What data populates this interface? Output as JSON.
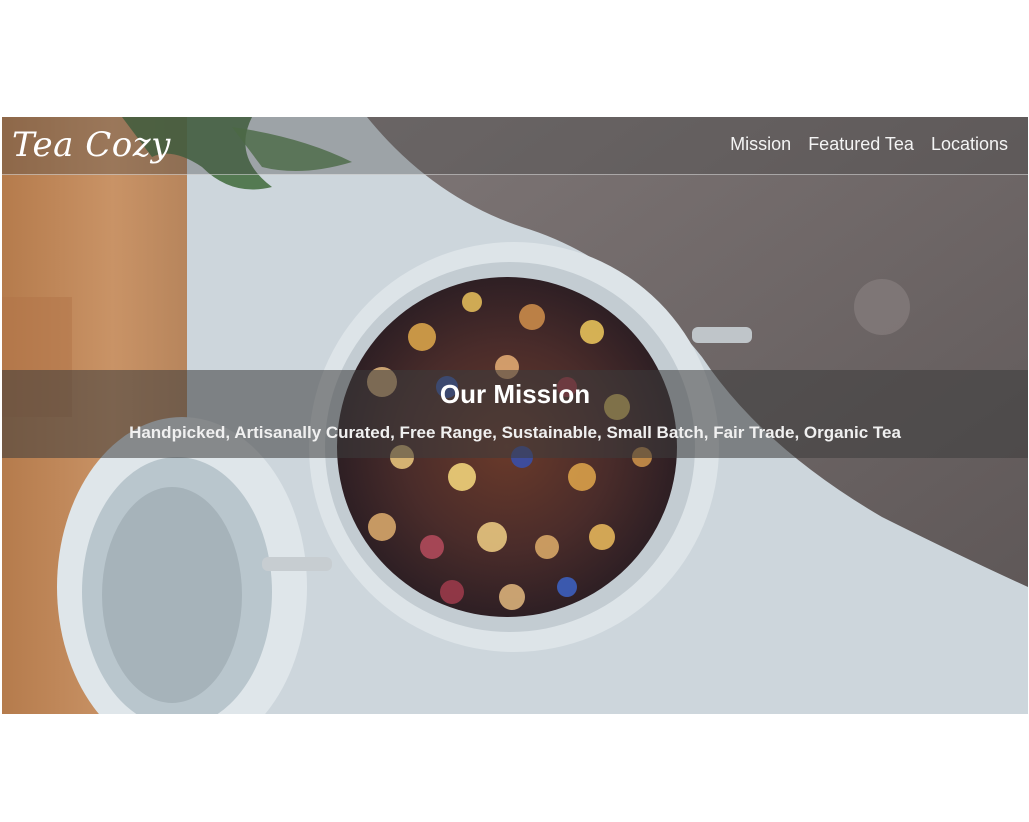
{
  "site": {
    "logo": "Tea Cozy"
  },
  "nav": {
    "items": [
      {
        "label": "Mission"
      },
      {
        "label": "Featured Tea"
      },
      {
        "label": "Locations"
      }
    ]
  },
  "hero": {
    "title": "Our Mission",
    "subtitle": "Handpicked, Artisanally Curated, Free Range, Sustainable, Small Batch, Fair Trade, Organic Tea",
    "image": "jar-of-loose-leaf-tea-photo"
  },
  "colors": {
    "page_background": "#ffffff",
    "text": "#ffffff",
    "overlay": "#3c3c3c"
  }
}
